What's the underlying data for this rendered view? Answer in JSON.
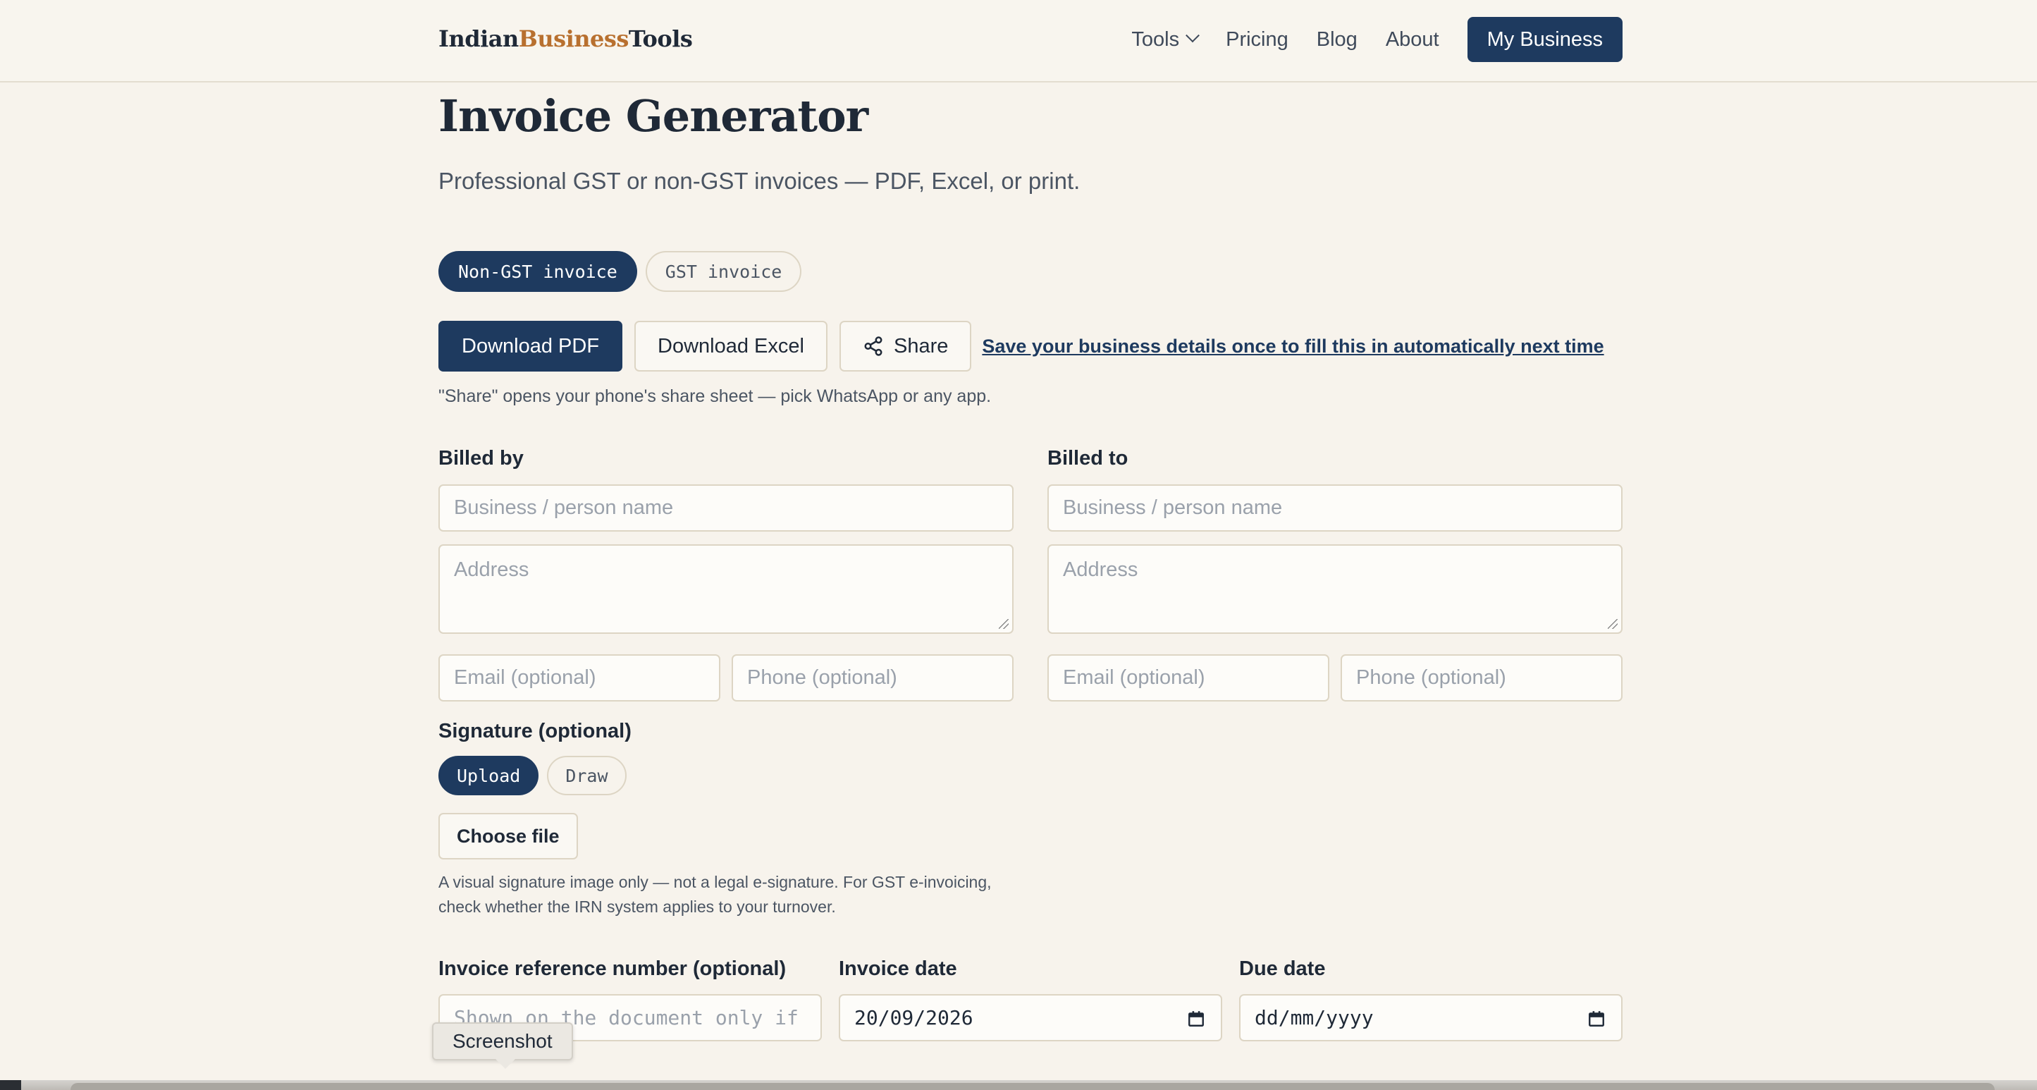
{
  "header": {
    "logo": {
      "part1": "Indian",
      "part2": "Business",
      "part3": "Tools"
    },
    "nav": {
      "tools": "Tools",
      "pricing": "Pricing",
      "blog": "Blog",
      "about": "About",
      "my_business": "My Business"
    }
  },
  "page": {
    "title": "Invoice Generator",
    "subtitle": "Professional GST or non-GST invoices — PDF, Excel, or print."
  },
  "invoice_type": {
    "options": [
      "Non-GST invoice",
      "GST invoice"
    ],
    "selected": "Non-GST invoice"
  },
  "actions": {
    "download_pdf": "Download PDF",
    "download_excel": "Download Excel",
    "share": "Share",
    "save_link": "Save your business details once to fill this in automatically next time",
    "share_note": "\"Share\" opens your phone's share sheet — pick WhatsApp or any app."
  },
  "billed_by": {
    "label": "Billed by",
    "name_placeholder": "Business / person name",
    "address_placeholder": "Address",
    "email_placeholder": "Email (optional)",
    "phone_placeholder": "Phone (optional)"
  },
  "billed_to": {
    "label": "Billed to",
    "name_placeholder": "Business / person name",
    "address_placeholder": "Address",
    "email_placeholder": "Email (optional)",
    "phone_placeholder": "Phone (optional)"
  },
  "signature": {
    "label": "Signature (optional)",
    "modes": [
      "Upload",
      "Draw"
    ],
    "selected": "Upload",
    "choose_file": "Choose file",
    "note_line1": "A visual signature image only — not a legal e-signature. For GST e-invoicing,",
    "note_line2": "check whether the IRN system applies to your turnover."
  },
  "invoice_meta": {
    "reference_label": "Invoice reference number (optional)",
    "reference_placeholder": "Shown on the document only if",
    "date_label": "Invoice date",
    "date_value": "20/09/2026",
    "due_label": "Due date",
    "due_placeholder": "dd/mm/yyyy"
  },
  "tooltip": {
    "text": "Screenshot"
  },
  "colors": {
    "background": "#f7f3ec",
    "primary": "#1e3a5f",
    "logo_accent": "#b8702f",
    "border": "#ddd5c4"
  }
}
